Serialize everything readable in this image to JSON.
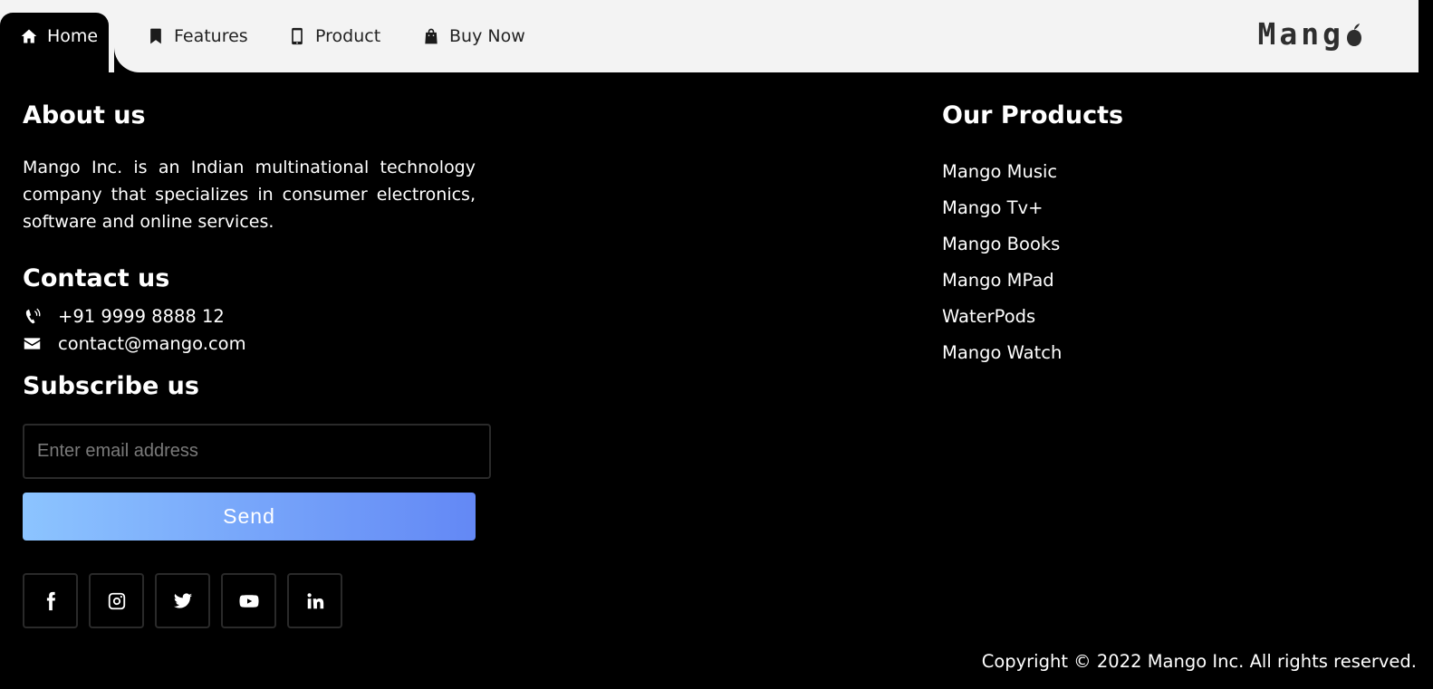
{
  "nav": {
    "items": [
      {
        "label": "Home",
        "icon": "home-icon",
        "active": true
      },
      {
        "label": "Features",
        "icon": "bookmark-icon"
      },
      {
        "label": "Product",
        "icon": "mobile-icon"
      },
      {
        "label": "Buy Now",
        "icon": "shopping-bag-icon"
      }
    ],
    "logo": "Mang"
  },
  "about": {
    "heading": "About us",
    "text": "Mango Inc. is an Indian multinational technology company that specializes in consumer electronics, software and online services."
  },
  "contact": {
    "heading": "Contact us",
    "phone": "+91 9999 8888 12",
    "email": "contact@mango.com"
  },
  "subscribe": {
    "heading": "Subscribe us",
    "placeholder": "Enter email address",
    "button": "Send"
  },
  "socials": [
    "facebook-icon",
    "instagram-icon",
    "twitter-icon",
    "youtube-icon",
    "linkedin-icon"
  ],
  "products": {
    "heading": "Our Products",
    "items": [
      "Mango Music",
      "Mango Tv+",
      "Mango Books",
      "Mango MPad",
      "WaterPods",
      "Mango Watch"
    ]
  },
  "copyright": "Copyright © 2022 Mango Inc. All rights reserved.",
  "colors": {
    "background": "#000000",
    "nav_bg": "#f3f3f3",
    "button_gradient_start": "#8cc4ff",
    "button_gradient_end": "#6388f5"
  }
}
